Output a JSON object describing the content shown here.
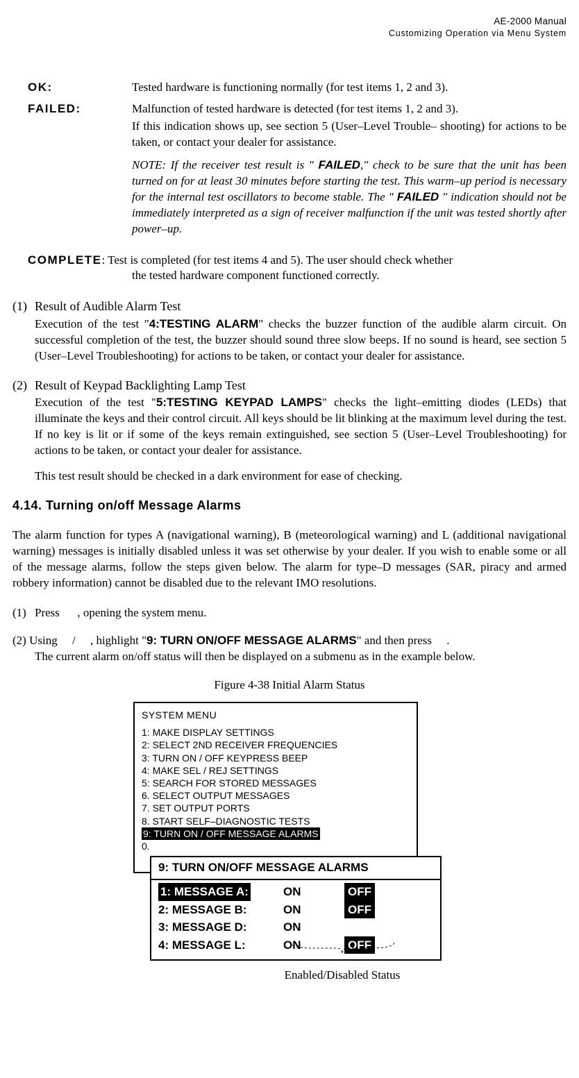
{
  "header": {
    "line1": "AE-2000 Manual",
    "line2": "Customizing Operation via Menu System"
  },
  "defs": {
    "ok": {
      "term": "OK",
      "colon": ":",
      "body": "Tested hardware is functioning normally (for test items 1, 2 and 3)."
    },
    "failed": {
      "term": "FAILED",
      "colon": ":",
      "body1": "Malfunction of tested hardware is detected (for test items 1, 2 and 3).",
      "body2": "If this indication shows up, see section 5 (User–Level Trouble– shooting) for actions to be taken, or contact your dealer for assistance.",
      "note_pre": "NOTE: If the receiver test result is \" ",
      "note_fail1": "FAILED",
      "note_mid": ",\" check to be sure that the unit has been turned on for at least 30 minutes before starting the test. This warm–up period is necessary for the internal test oscillators to become stable. The \" ",
      "note_fail2": "FAILED",
      "note_post": " \" indication should not be immediately interpreted as a sign of receiver malfunction if the unit was tested shortly after power–up."
    },
    "complete": {
      "term": "COMPLETE",
      "colon": ": ",
      "body1": "Test is completed (for test items 4 and 5). The user should check whether",
      "body2": "the tested hardware component functioned correctly."
    }
  },
  "sub1": {
    "num": "(1)",
    "title": "Result of Audible Alarm Test",
    "body_pre": "Execution of the test \"",
    "body_bold": "4:TESTING ALARM",
    "body_post": "\" checks the buzzer function of the audible alarm circuit. On successful completion of the test, the buzzer should sound three slow beeps. If no sound is heard, see section 5 (User–Level Troubleshooting) for actions to be taken, or contact your dealer for assistance."
  },
  "sub2": {
    "num": "(2)",
    "title": "Result of Keypad Backlighting Lamp Test",
    "body_pre": "Execution of the test \"",
    "body_bold": "5:TESTING KEYPAD LAMPS",
    "body_post": "\" checks the light–emitting diodes (LEDs) that illuminate the keys and their control circuit. All keys should be lit blinking at the maximum level during the test. If no key is lit or if some of the keys remain extinguished, see section 5 (User–Level Troubleshooting) for actions to be taken, or contact your dealer for assistance.",
    "extra": "This test result should be checked in a dark environment for ease of checking."
  },
  "sec414": {
    "title": "4.14.  Turning on/off Message Alarms",
    "para": "The alarm function for types A (navigational warning), B (meteorological warning) and L (additional navigational warning) messages is initially disabled unless it was set otherwise by your dealer. If you wish to enable some or all of the message alarms, follow the steps given below. The alarm for type–D messages (SAR, piracy and armed robbery information) cannot be disabled due to the relevant IMO resolutions."
  },
  "step1": {
    "num": "(1)",
    "pre": "Press",
    "post": ", opening the system menu."
  },
  "step2": {
    "num": "(2) ",
    "pre": "Using",
    "mid1": "/",
    "mid2": ", highlight \"",
    "bold": "9: TURN ON/OFF MESSAGE ALARMS",
    "post": "\" and then press",
    "end": ".",
    "line2": "The current alarm on/off status will then be displayed on a submenu as in the example below."
  },
  "fig": {
    "caption": "Figure 4-38   Initial Alarm Status"
  },
  "sysmenu": {
    "title": "SYSTEM MENU",
    "items": [
      "1:   MAKE DISPLAY SETTINGS",
      "2:    SELECT 2ND RECEIVER FREQUENCIES",
      "3:    TURN ON / OFF KEYPRESS BEEP",
      "4:    MAKE SEL / REJ SETTINGS",
      "5:    SEARCH FOR STORED MESSAGES",
      "6.    SELECT OUTPUT MESSAGES",
      "7.    SET OUTPUT PORTS",
      "8.    START SELF–DIAGNOSTIC TESTS"
    ],
    "hl": "9:    TURN ON / OFF MESSAGE ALARMS",
    "last": "0."
  },
  "submenu": {
    "title": "9: TURN ON/OFF MESSAGE ALARMS",
    "rows": [
      {
        "label": "1: MESSAGE A:",
        "hl": true,
        "on": "ON",
        "off": "OFF",
        "offhl": true
      },
      {
        "label": "2: MESSAGE B:",
        "hl": false,
        "on": "ON",
        "off": "OFF",
        "offhl": true
      },
      {
        "label": "3: MESSAGE D:",
        "hl": false,
        "on": "ON",
        "off": "",
        "offhl": false
      },
      {
        "label": "4: MESSAGE L:",
        "hl": false,
        "on": "ON",
        "off": "OFF",
        "offhl": true
      }
    ]
  },
  "brace": {
    "label": "Enabled/Disabled Status"
  }
}
